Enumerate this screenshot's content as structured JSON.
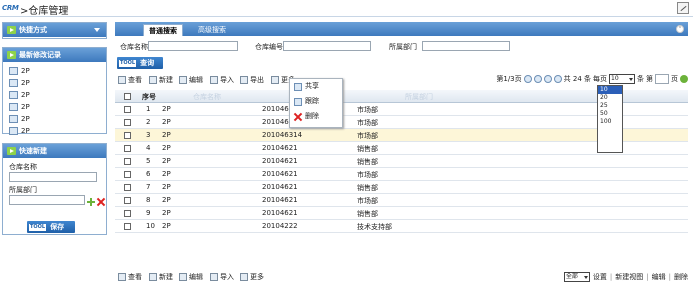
{
  "app": {
    "logo": "CRM",
    "title": ">仓库管理"
  },
  "sidebar": {
    "shortcuts_title": "快捷方式",
    "recent_title": "最新修改记录",
    "recent_items": [
      "2P",
      "2P",
      "2P",
      "2P",
      "2P",
      "2P"
    ],
    "quick_new_title": "快速新建",
    "field_name_label": "仓库名称",
    "field_dept_label": "所属部门",
    "save_label": "保存",
    "tool_badge": "TOOL"
  },
  "tabs": {
    "normal": "普通搜索",
    "advanced": "高级搜索"
  },
  "search": {
    "name_label": "仓库名称",
    "code_label": "仓库编号",
    "dept_label": "所属部门",
    "query_label": "查询",
    "tool_badge": "TOOL"
  },
  "toolbar": {
    "view": "查看",
    "new": "新建",
    "edit": "编辑",
    "import": "导入",
    "export": "导出",
    "more": "更多"
  },
  "pager": {
    "page_info": "第1/3页",
    "total": "共 24 条",
    "per_page_label": "每页",
    "per_page_value": "10",
    "unit": "条",
    "goto_label": "第",
    "page_unit": "页"
  },
  "per_page_options": [
    "10",
    "20",
    "25",
    "50",
    "100"
  ],
  "context_menu": {
    "share": "共享",
    "track": "跟踪",
    "delete": "删除"
  },
  "grid": {
    "header_index": "序号",
    "header_name": "仓库名称",
    "header_dept": "所属部门",
    "rows": [
      {
        "idx": "1",
        "name": "2P",
        "code": "20104631",
        "dept": "市场部"
      },
      {
        "idx": "2",
        "name": "2P",
        "code": "20104631",
        "dept": "市场部"
      },
      {
        "idx": "3",
        "name": "2P",
        "code": "201046314",
        "dept": "市场部"
      },
      {
        "idx": "4",
        "name": "2P",
        "code": "20104621",
        "dept": "销售部"
      },
      {
        "idx": "5",
        "name": "2P",
        "code": "20104621",
        "dept": "销售部"
      },
      {
        "idx": "6",
        "name": "2P",
        "code": "20104621",
        "dept": "市场部"
      },
      {
        "idx": "7",
        "name": "2P",
        "code": "20104621",
        "dept": "销售部"
      },
      {
        "idx": "8",
        "name": "2P",
        "code": "20104621",
        "dept": "市场部"
      },
      {
        "idx": "9",
        "name": "2P",
        "code": "20104621",
        "dept": "销售部"
      },
      {
        "idx": "10",
        "name": "2P",
        "code": "20104222",
        "dept": "技术支持部"
      }
    ]
  },
  "bottom": {
    "view": "查看",
    "new": "新建",
    "edit": "编辑",
    "import": "导入",
    "more": "更多",
    "view_select": "全部",
    "settings": "设置",
    "new_view": "新建视图",
    "edit_view": "编辑",
    "delete_view": "删除"
  },
  "colors": {
    "header_blue": "#3d79bd",
    "row_highlight": "#fdf6d8",
    "accent_green": "#6cb23a"
  }
}
